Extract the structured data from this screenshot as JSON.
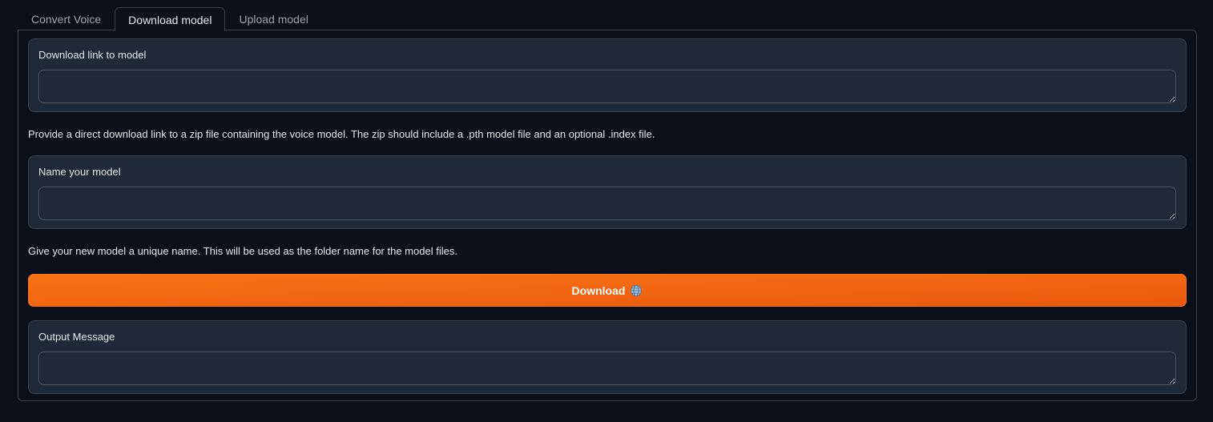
{
  "tabs": [
    {
      "label": "Convert Voice",
      "selected": false
    },
    {
      "label": "Download model",
      "selected": true
    },
    {
      "label": "Upload model",
      "selected": false
    }
  ],
  "download_link": {
    "label": "Download link to model",
    "value": "",
    "info": "Provide a direct download link to a zip file containing the voice model. The zip should include a .pth model file and an optional .index file."
  },
  "model_name": {
    "label": "Name your model",
    "value": "",
    "info": "Give your new model a unique name. This will be used as the folder name for the model files."
  },
  "download_button": {
    "label": "Download",
    "icon": "globe-icon"
  },
  "output_message": {
    "label": "Output Message",
    "value": ""
  },
  "colors": {
    "background": "#0b0f19",
    "block": "#1f2937",
    "border": "#374151",
    "accent": "#f97316"
  }
}
